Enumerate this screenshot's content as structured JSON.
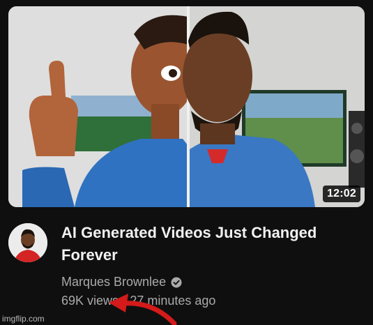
{
  "video": {
    "title": "AI Generated Videos Just Changed Forever",
    "channel": "Marques Brownlee",
    "views": "69K views",
    "separator": "•",
    "age": "27 minutes ago",
    "duration": "12:02",
    "verified_icon": "verified-check-icon"
  },
  "watermark": "imgflip.com",
  "colors": {
    "background": "#0f0f0f",
    "title": "#f1f1f1",
    "secondary_text": "#aaaaaa",
    "annotation_arrow": "#d41a1a",
    "hoodie_blue": "#2f72c2"
  }
}
